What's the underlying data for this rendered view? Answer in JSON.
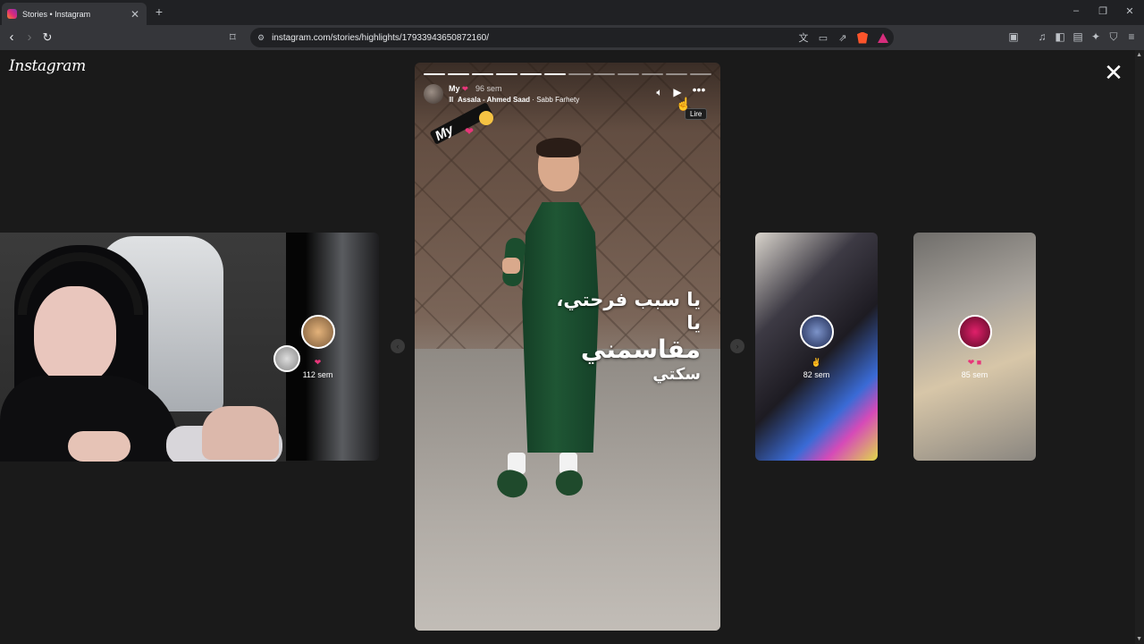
{
  "browser": {
    "tab_title": "Stories • Instagram",
    "url": "instagram.com/stories/highlights/17933943650872160/"
  },
  "instagram": {
    "logo_text": "Instagram"
  },
  "story": {
    "progress_total": 12,
    "progress_done": 6,
    "username": "My",
    "time": "96 sem",
    "music_artist": "Assala - Ahmed Saad",
    "music_title": "Sabb Farhety",
    "tooltip": "Lire",
    "sticker_text": "My",
    "arabic_line1": "يا سبب فرحتي، يا",
    "arabic_line2": "مقاسمني",
    "arabic_line3": "سكتي"
  },
  "previews": [
    {
      "time": "112 sem",
      "bg": "#0f0f0f",
      "avatar": "#c9a06a"
    },
    {
      "time": "82 sem",
      "bg": "#2b2730",
      "avatar": "#6a7fb3"
    },
    {
      "time": "85 sem",
      "bg": "#8c8a86",
      "avatar": "#b0124a"
    }
  ],
  "colors": {
    "accent_pink": "#e8367a",
    "background": "#1a1a1a"
  }
}
